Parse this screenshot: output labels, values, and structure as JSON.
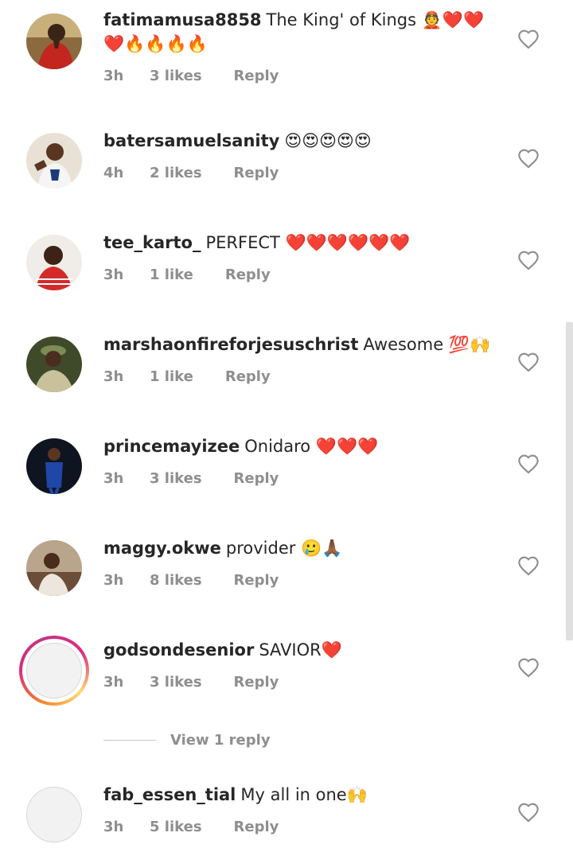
{
  "comments": [
    {
      "username": "fatimamusa8858",
      "text": "The King' of Kings 👲❤️❤️❤️🔥🔥🔥🔥",
      "time": "3h",
      "likes": "3 likes",
      "reply": "Reply"
    },
    {
      "username": "batersamuelsanity",
      "text": "😍😍😍😍😍",
      "time": "4h",
      "likes": "2 likes",
      "reply": "Reply"
    },
    {
      "username": "tee_karto_",
      "text": "PERFECT ❤️❤️❤️❤️❤️❤️",
      "time": "3h",
      "likes": "1 like",
      "reply": "Reply"
    },
    {
      "username": "marshaonfireforjesuschrist",
      "text": "Awesome 💯🙌",
      "time": "3h",
      "likes": "1 like",
      "reply": "Reply"
    },
    {
      "username": "princemayizee",
      "text": "Onidaro ❤️❤️❤️",
      "time": "3h",
      "likes": "3 likes",
      "reply": "Reply"
    },
    {
      "username": "maggy.okwe",
      "text": "provider 🥲🙏🏾",
      "time": "3h",
      "likes": "8 likes",
      "reply": "Reply"
    },
    {
      "username": "godsondesenior",
      "text": "SAVIOR❤️",
      "time": "3h",
      "likes": "3 likes",
      "reply": "Reply"
    },
    {
      "username": "fab_essen_tial",
      "text": "My all in one🙌",
      "time": "3h",
      "likes": "5 likes",
      "reply": "Reply"
    }
  ],
  "view_replies_label": "View 1 reply",
  "icons": {
    "like": "heart-outline-icon"
  },
  "colors": {
    "text": "#262626",
    "secondary": "#8e8e8e",
    "story_ring_start": "#f58529",
    "story_ring_end": "#dd2a7b"
  }
}
